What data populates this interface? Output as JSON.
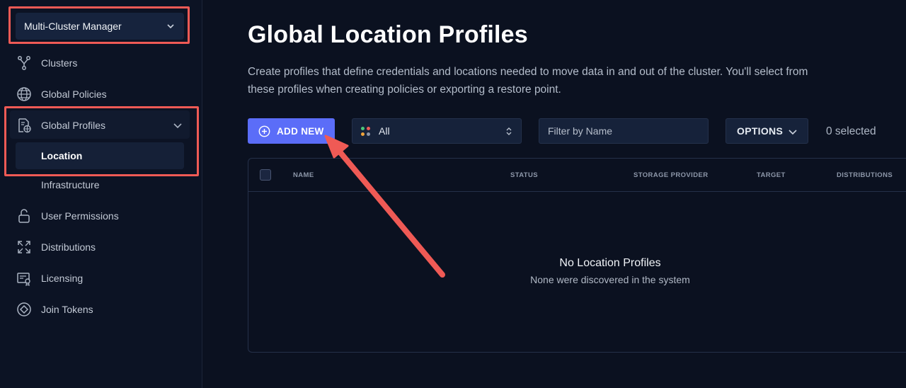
{
  "sidebar": {
    "cluster_selector": "Multi-Cluster Manager",
    "items": [
      {
        "label": "Clusters",
        "icon": "cluster-icon"
      },
      {
        "label": "Global Policies",
        "icon": "globe-icon"
      },
      {
        "label": "Global Profiles",
        "icon": "profile-icon"
      },
      {
        "label": "Location"
      },
      {
        "label": "Infrastructure"
      },
      {
        "label": "User Permissions",
        "icon": "lock-icon"
      },
      {
        "label": "Distributions",
        "icon": "expand-icon"
      },
      {
        "label": "Licensing",
        "icon": "certificate-icon"
      },
      {
        "label": "Join Tokens",
        "icon": "token-icon"
      }
    ]
  },
  "main": {
    "title": "Global Location Profiles",
    "description": "Create profiles that define credentials and locations needed to move data in and out of the cluster. You'll select from these profiles when creating policies or exporting a restore point.",
    "add_new_label": "ADD NEW",
    "status_filter_value": "All",
    "name_filter_placeholder": "Filter by Name",
    "options_label": "OPTIONS",
    "selected_count": "0 selected",
    "table": {
      "columns": [
        "NAME",
        "STATUS",
        "STORAGE PROVIDER",
        "TARGET",
        "DISTRIBUTIONS"
      ],
      "rows": [],
      "empty_title": "No Location Profiles",
      "empty_subtitle": "None were discovered in the system"
    }
  },
  "colors": {
    "accent": "#5b6df8",
    "highlight": "#ef5a55",
    "background": "#0b1120"
  }
}
